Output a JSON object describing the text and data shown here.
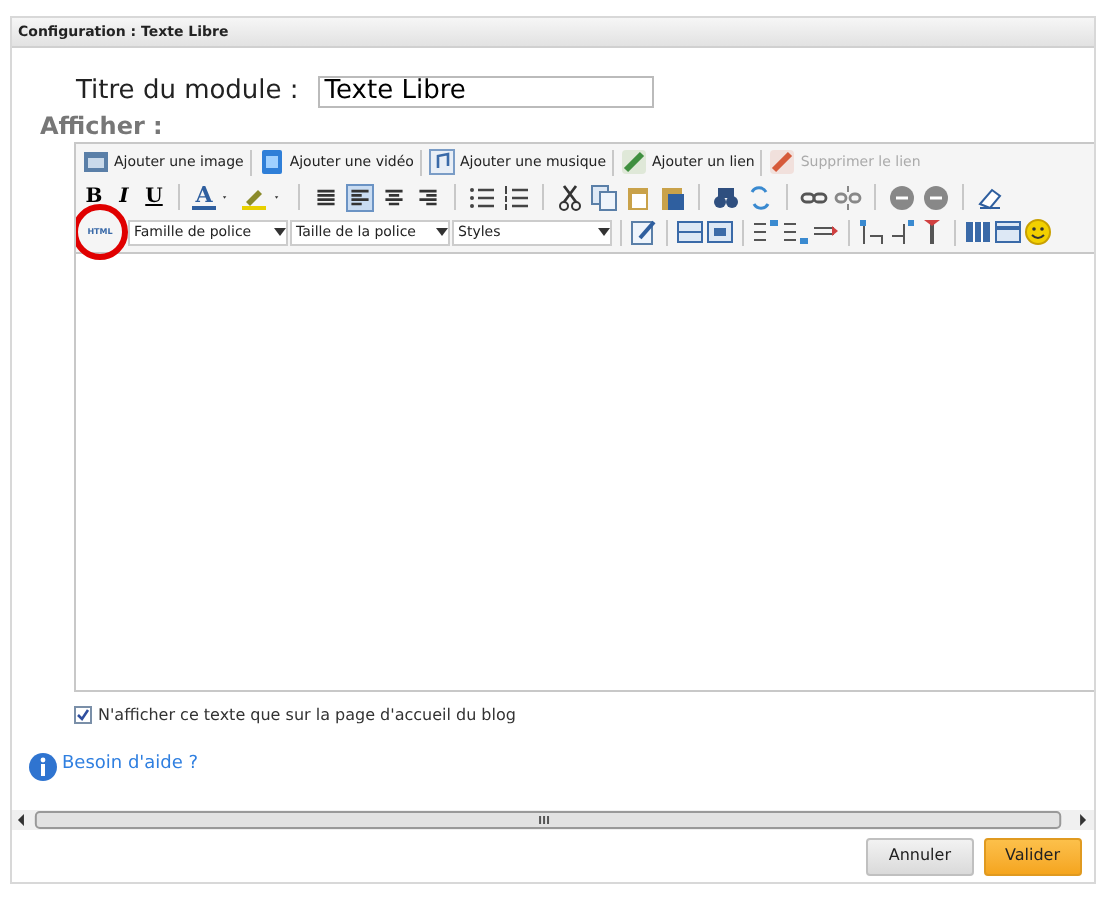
{
  "dialog": {
    "title": "Configuration : Texte Libre"
  },
  "module_title": {
    "label": "Titre du module :",
    "value": "Texte Libre"
  },
  "section_label": "Afficher :",
  "insert_toolbar": [
    {
      "label": "Ajouter une image",
      "disabled": false
    },
    {
      "label": "Ajouter une vidéo",
      "disabled": false
    },
    {
      "label": "Ajouter une musique",
      "disabled": false
    },
    {
      "label": "Ajouter un lien",
      "disabled": false
    },
    {
      "label": "Supprimer le lien",
      "disabled": true
    }
  ],
  "format_buttons": [
    "B",
    "I",
    "U"
  ],
  "font_color_button": "A",
  "alignment": [
    {
      "selected": false
    },
    {
      "selected": true
    },
    {
      "selected": false
    },
    {
      "selected": false
    }
  ],
  "html_button": {
    "label": "HTML",
    "highlighted": true
  },
  "selects": [
    {
      "placeholder": "Famille de police"
    },
    {
      "placeholder": "Taille de la police"
    },
    {
      "placeholder": "Styles"
    }
  ],
  "home_only": {
    "label": "N'afficher ce texte que sur la page d'accueil du blog",
    "checked": true
  },
  "help_link": "Besoin d'aide ?",
  "buttons": [
    {
      "label": "Annuler",
      "primary": false
    },
    {
      "label": "Valider",
      "primary": true
    }
  ]
}
